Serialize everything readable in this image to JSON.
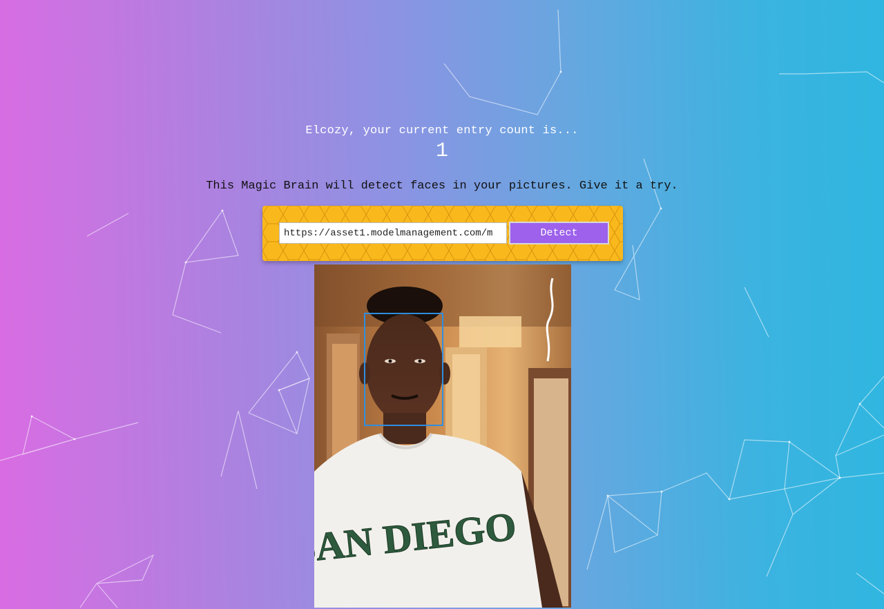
{
  "rank": {
    "greeting": "Elcozy, your current entry count is...",
    "entry_count": "1"
  },
  "instruction": "This Magic Brain will detect faces in your pictures. Give it a try.",
  "image_link_form": {
    "input_value": "https://asset1.modelmanagement.com/m",
    "detect_label": "Detect"
  },
  "result": {
    "shirt_text": "SAN DIEGO",
    "faces_detected": 1,
    "accent_color": "#2f8ee0"
  },
  "colors": {
    "gradient_left": "#d96ce2",
    "gradient_right": "#2fb6e0",
    "panel_yellow": "#f9b91d",
    "button_purple": "#9d61eb"
  }
}
